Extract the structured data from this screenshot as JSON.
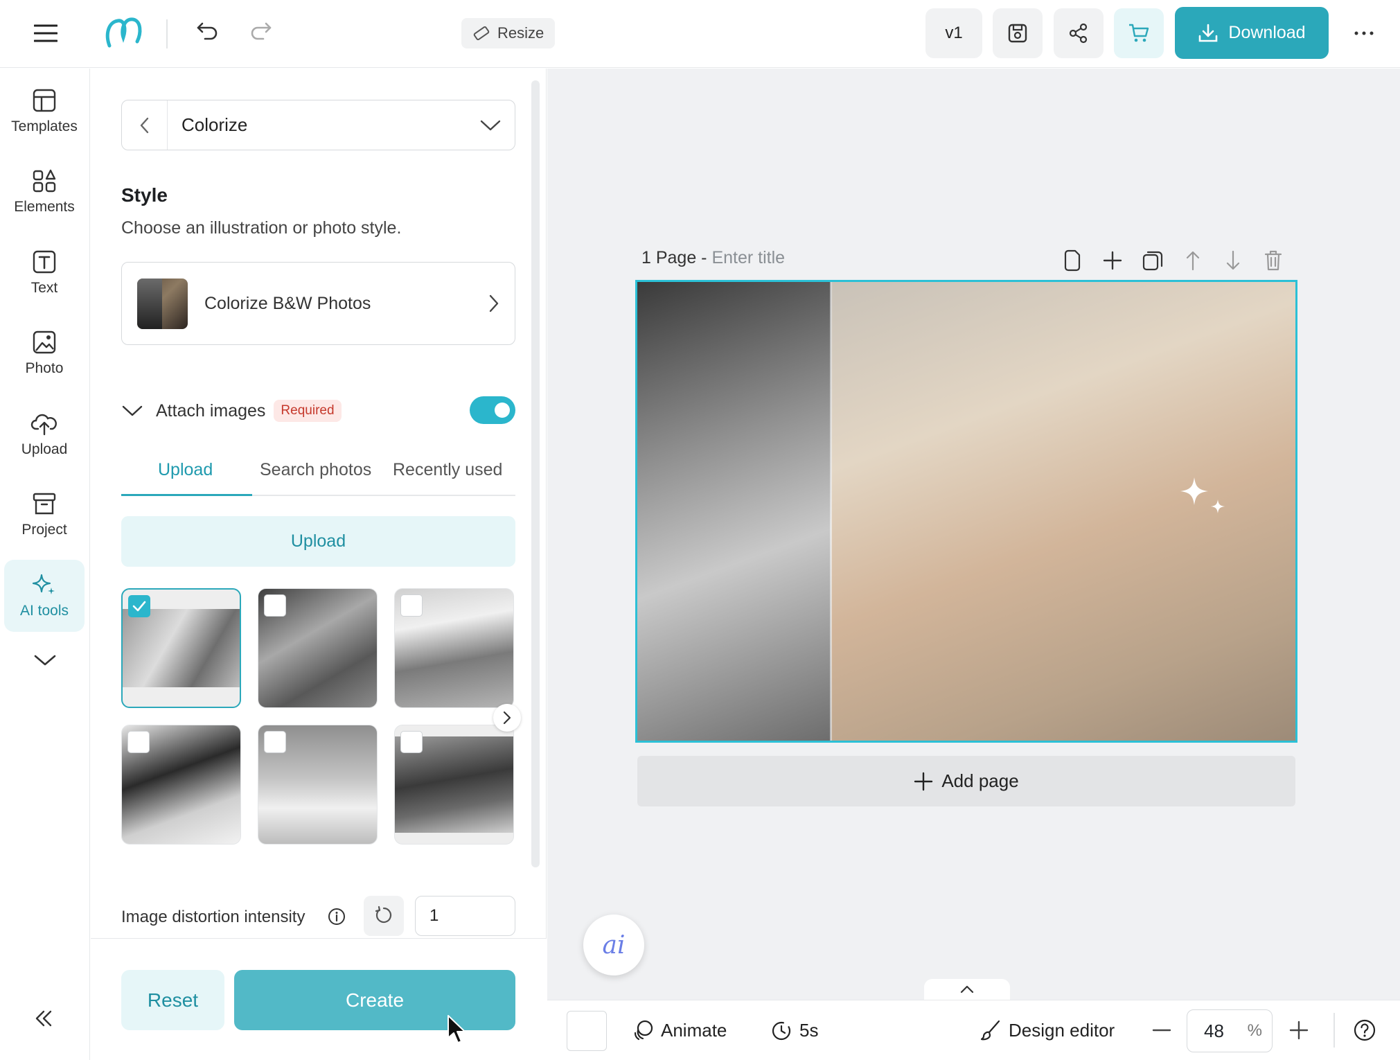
{
  "topbar": {
    "resize_label": "Resize",
    "version_label": "v1",
    "download_label": "Download"
  },
  "rail": {
    "items": [
      {
        "label": "Templates",
        "icon": "layout-icon"
      },
      {
        "label": "Elements",
        "icon": "shapes-icon"
      },
      {
        "label": "Text",
        "icon": "text-icon"
      },
      {
        "label": "Photo",
        "icon": "image-icon"
      },
      {
        "label": "Upload",
        "icon": "cloud-upload-icon"
      },
      {
        "label": "Project",
        "icon": "archive-icon"
      },
      {
        "label": "AI tools",
        "icon": "sparkle-icon",
        "active": true
      }
    ]
  },
  "panel": {
    "tool_select": "Colorize",
    "style_title": "Style",
    "style_subtitle": "Choose an illustration or photo style.",
    "style_choice": "Colorize B&W Photos",
    "attach_label": "Attach images",
    "required_badge": "Required",
    "attach_enabled": true,
    "tabs": [
      "Upload",
      "Search photos",
      "Recently used"
    ],
    "active_tab": "Upload",
    "upload_button": "Upload",
    "distortion_label": "Image distortion intensity",
    "distortion_value": "1",
    "reset_label": "Reset",
    "create_label": "Create"
  },
  "canvas": {
    "page_label": "1 Page -",
    "title_placeholder": "Enter title",
    "add_page_label": "Add page",
    "ai_fab_label": "ai"
  },
  "bottombar": {
    "animate_label": "Animate",
    "duration_label": "5s",
    "design_editor_label": "Design editor",
    "zoom_value": "48",
    "zoom_unit": "%"
  },
  "colors": {
    "accent": "#2ba8ba",
    "accent_light": "#e6f6f8",
    "selection_border": "#2bc0d6",
    "required_text": "#c5382b"
  }
}
